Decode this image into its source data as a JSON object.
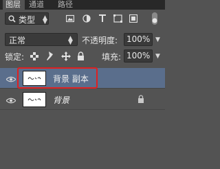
{
  "tabs": [
    {
      "label": "图层",
      "active": true
    },
    {
      "label": "通道",
      "active": false
    },
    {
      "label": "路径",
      "active": false
    }
  ],
  "filter": {
    "type_label": "类型",
    "icons": [
      "search-icon",
      "image-filter-icon",
      "adjustment-filter-icon",
      "type-filter-icon",
      "shape-filter-icon",
      "smart-object-filter-icon",
      "toggle-filter-icon"
    ]
  },
  "blend": {
    "mode": "正常",
    "opacity_label": "不透明度:",
    "opacity_value": "100%"
  },
  "lock": {
    "label": "锁定:",
    "icons": [
      "lock-transparent-pixels-icon",
      "lock-image-pixels-icon",
      "lock-position-icon",
      "lock-all-icon"
    ],
    "fill_label": "填充:",
    "fill_value": "100%"
  },
  "layers": [
    {
      "name": "背景 副本",
      "selected": true,
      "italic": false,
      "locked": false
    },
    {
      "name": "背景",
      "selected": false,
      "italic": true,
      "locked": true
    }
  ],
  "colors": {
    "panel_bg": "#535353",
    "selected_row": "#5a6e8c",
    "highlight": "#e02020"
  }
}
